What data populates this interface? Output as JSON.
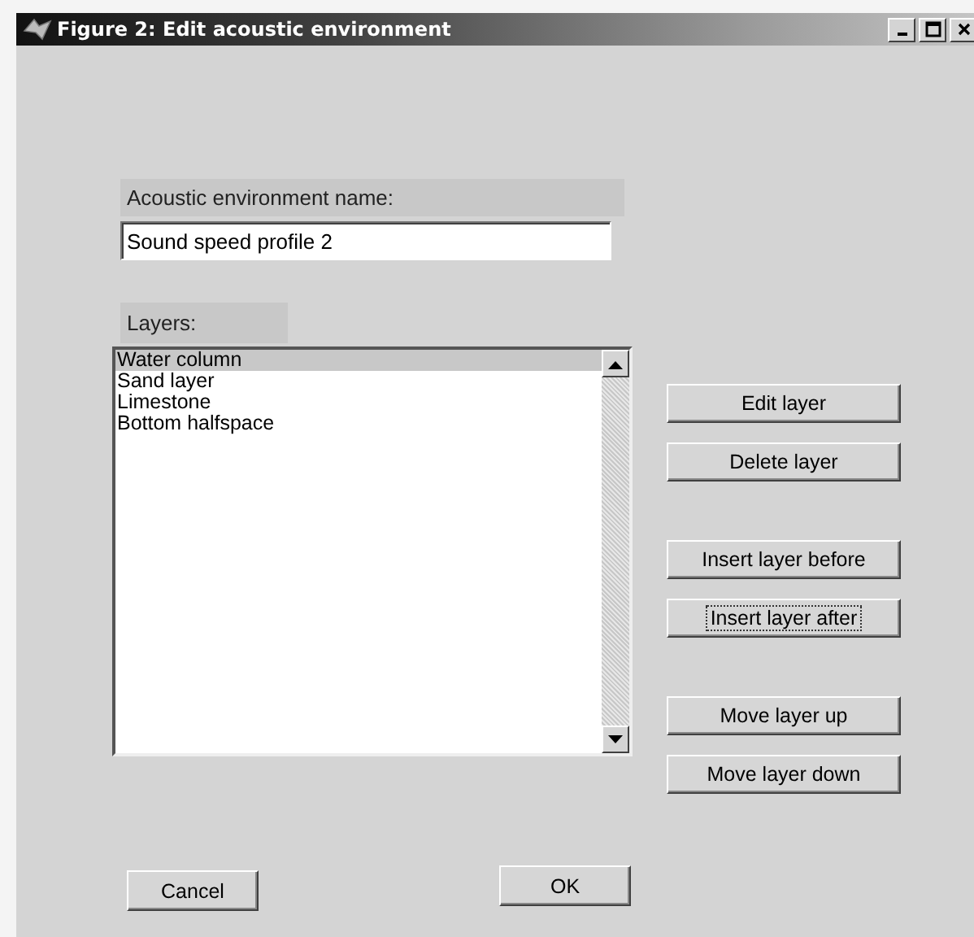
{
  "window": {
    "title": "Figure 2: Edit acoustic environment"
  },
  "name_field": {
    "label": "Acoustic environment name:",
    "value": "Sound speed profile 2"
  },
  "layers": {
    "label": "Layers:",
    "items": [
      {
        "label": "Water column",
        "selected": true
      },
      {
        "label": "Sand layer",
        "selected": false
      },
      {
        "label": "Limestone",
        "selected": false
      },
      {
        "label": "Bottom halfspace",
        "selected": false
      }
    ]
  },
  "side_button_groups": [
    [
      {
        "label": "Edit layer",
        "focused": false
      },
      {
        "label": "Delete layer",
        "focused": false
      }
    ],
    [
      {
        "label": "Insert layer before",
        "focused": false
      },
      {
        "label": "Insert layer after",
        "focused": true
      }
    ],
    [
      {
        "label": "Move layer up",
        "focused": false
      },
      {
        "label": "Move layer down",
        "focused": false
      }
    ]
  ],
  "bottom_buttons": [
    {
      "label": "Cancel"
    },
    {
      "label": "OK"
    }
  ]
}
